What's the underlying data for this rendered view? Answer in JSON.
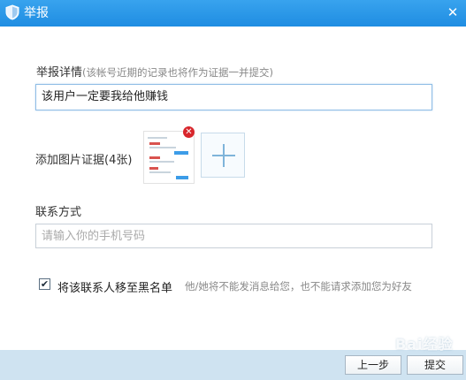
{
  "window": {
    "title": "举报",
    "close_glyph": "✕"
  },
  "report": {
    "label": "举报详情",
    "hint": "(该帐号近期的记录也将作为证据一并提交)",
    "value": "该用户一定要我给他赚钱"
  },
  "images": {
    "label": "添加图片证据(4张)",
    "remove_glyph": "✕",
    "thumbnail_icon": "chat-screenshot-thumbnail",
    "add_icon": "plus-icon"
  },
  "contact": {
    "label": "联系方式",
    "placeholder": "请输入你的手机号码"
  },
  "blacklist": {
    "checked": true,
    "check_glyph": "✔",
    "label": "将该联系人移至黑名单",
    "note": "他/她将不能发消息给您，也不能请求添加您为好友"
  },
  "buttons": {
    "prev": "上一步",
    "submit": "提交"
  },
  "watermark": "Bai经验",
  "colors": {
    "title_bar": "#1f8de2",
    "footer": "#cfe3f1",
    "remove_badge": "#d8262c"
  }
}
